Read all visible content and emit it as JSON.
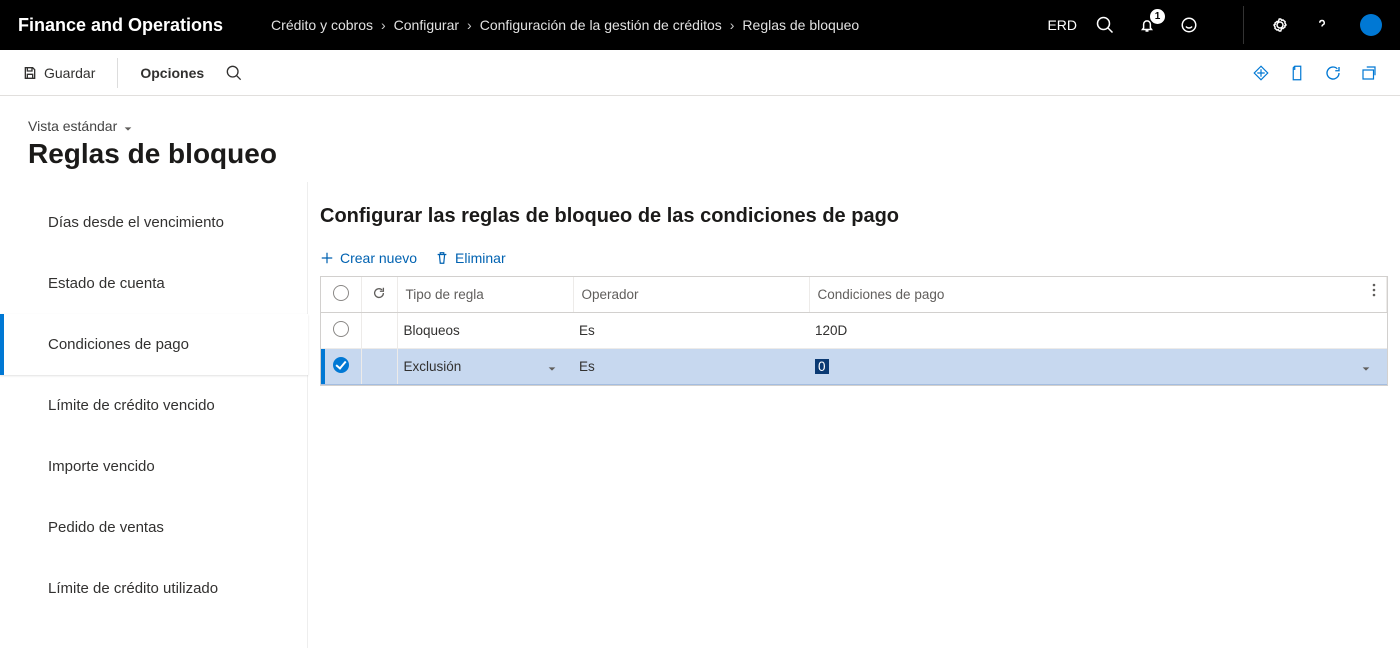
{
  "header": {
    "app": "Finance and Operations",
    "breadcrumbs": [
      "Crédito y cobros",
      "Configurar",
      "Configuración de la gestión de créditos",
      "Reglas de bloqueo"
    ],
    "company": "ERD",
    "notification_count": "1"
  },
  "toolbar": {
    "save": "Guardar",
    "options": "Opciones"
  },
  "page": {
    "view": "Vista estándar",
    "title": "Reglas de bloqueo"
  },
  "nav": {
    "items": [
      {
        "label": "Días desde el vencimiento",
        "active": false
      },
      {
        "label": "Estado de cuenta",
        "active": false
      },
      {
        "label": "Condiciones de pago",
        "active": true
      },
      {
        "label": "Límite de crédito vencido",
        "active": false
      },
      {
        "label": "Importe vencido",
        "active": false
      },
      {
        "label": "Pedido de ventas",
        "active": false
      },
      {
        "label": "Límite de crédito utilizado",
        "active": false
      }
    ]
  },
  "content": {
    "heading": "Configurar las reglas de bloqueo de las condiciones de pago",
    "actions": {
      "new": "Crear nuevo",
      "delete": "Eliminar"
    },
    "columns": {
      "ruleType": "Tipo de regla",
      "operator": "Operador",
      "payTerms": "Condiciones de pago"
    },
    "rows": [
      {
        "selected": false,
        "ruleType": "Bloqueos",
        "operator": "Es",
        "payTerms": "120D"
      },
      {
        "selected": true,
        "ruleType": "Exclusión",
        "operator": "Es",
        "payTerms": "0"
      }
    ]
  }
}
